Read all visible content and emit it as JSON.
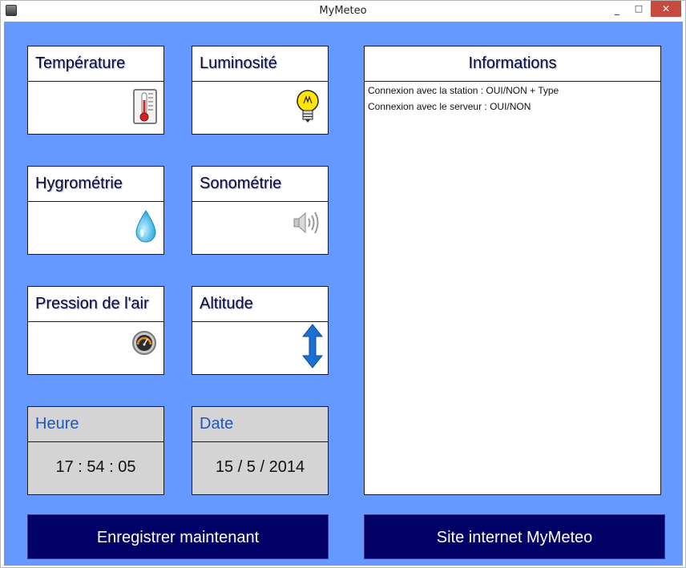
{
  "window": {
    "title": "MyMeteo",
    "controls": {
      "minimize": "_",
      "maximize": "□",
      "close": "✕"
    }
  },
  "sensors": {
    "temperature": {
      "label": "Température",
      "icon": "thermometer-icon",
      "value": ""
    },
    "luminosity": {
      "label": "Luminosité",
      "icon": "lightbulb-icon",
      "value": ""
    },
    "hygrometry": {
      "label": "Hygrométrie",
      "icon": "water-drop-icon",
      "value": ""
    },
    "sonometry": {
      "label": "Sonométrie",
      "icon": "speaker-icon",
      "value": ""
    },
    "pressure": {
      "label": "Pression de l'air",
      "icon": "pressure-gauge-icon",
      "value": ""
    },
    "altitude": {
      "label": "Altitude",
      "icon": "up-down-arrow-icon",
      "value": ""
    }
  },
  "clock": {
    "time_label": "Heure",
    "time_value": "17 : 54 : 05",
    "date_label": "Date",
    "date_value": "15 / 5 / 2014"
  },
  "info": {
    "title": "Informations",
    "lines": [
      "Connexion avec la station : OUI/NON + Type",
      "Connexion avec le serveur : OUI/NON"
    ]
  },
  "actions": {
    "save_now": "Enregistrer maintenant",
    "website": "Site internet MyMeteo"
  },
  "colors": {
    "background": "#6699ff",
    "button": "#000066",
    "panel": "#ffffff",
    "clock_panel": "#d4d4d4",
    "close": "#c74a3f"
  }
}
